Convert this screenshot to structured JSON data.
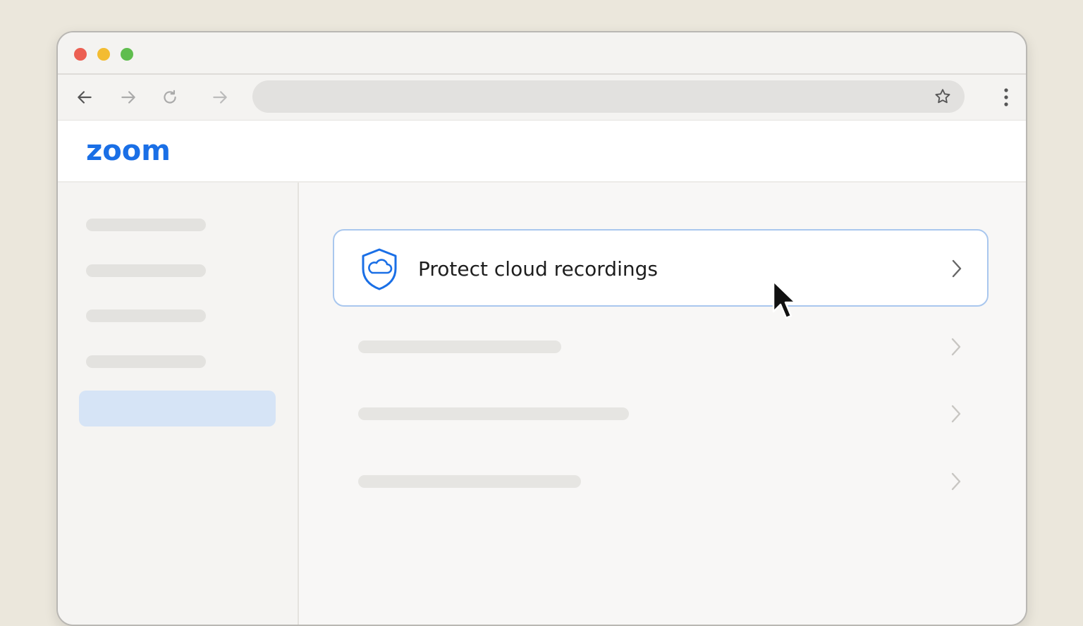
{
  "browser": {
    "window_controls": [
      "close",
      "minimize",
      "maximize"
    ],
    "nav_icons": [
      "back-arrow-icon",
      "forward-arrow-icon",
      "reload-icon",
      "go-arrow-icon"
    ],
    "address_value": "",
    "bookmark_icon": "star-icon",
    "menu_icon": "kebab-menu-icon"
  },
  "app": {
    "logo_text": "zoom",
    "brand_color": "#1a6fe6"
  },
  "sidebar": {
    "item_count": 4,
    "active_item_color": "#d6e4f6"
  },
  "main": {
    "highlighted_card": {
      "icon": "shield-cloud-icon",
      "title": "Protect cloud recordings",
      "chevron": "chevron-right-icon",
      "border_color": "#a9c7ee"
    },
    "placeholder_row_count": 3
  },
  "cursor": "arrow-cursor-icon"
}
